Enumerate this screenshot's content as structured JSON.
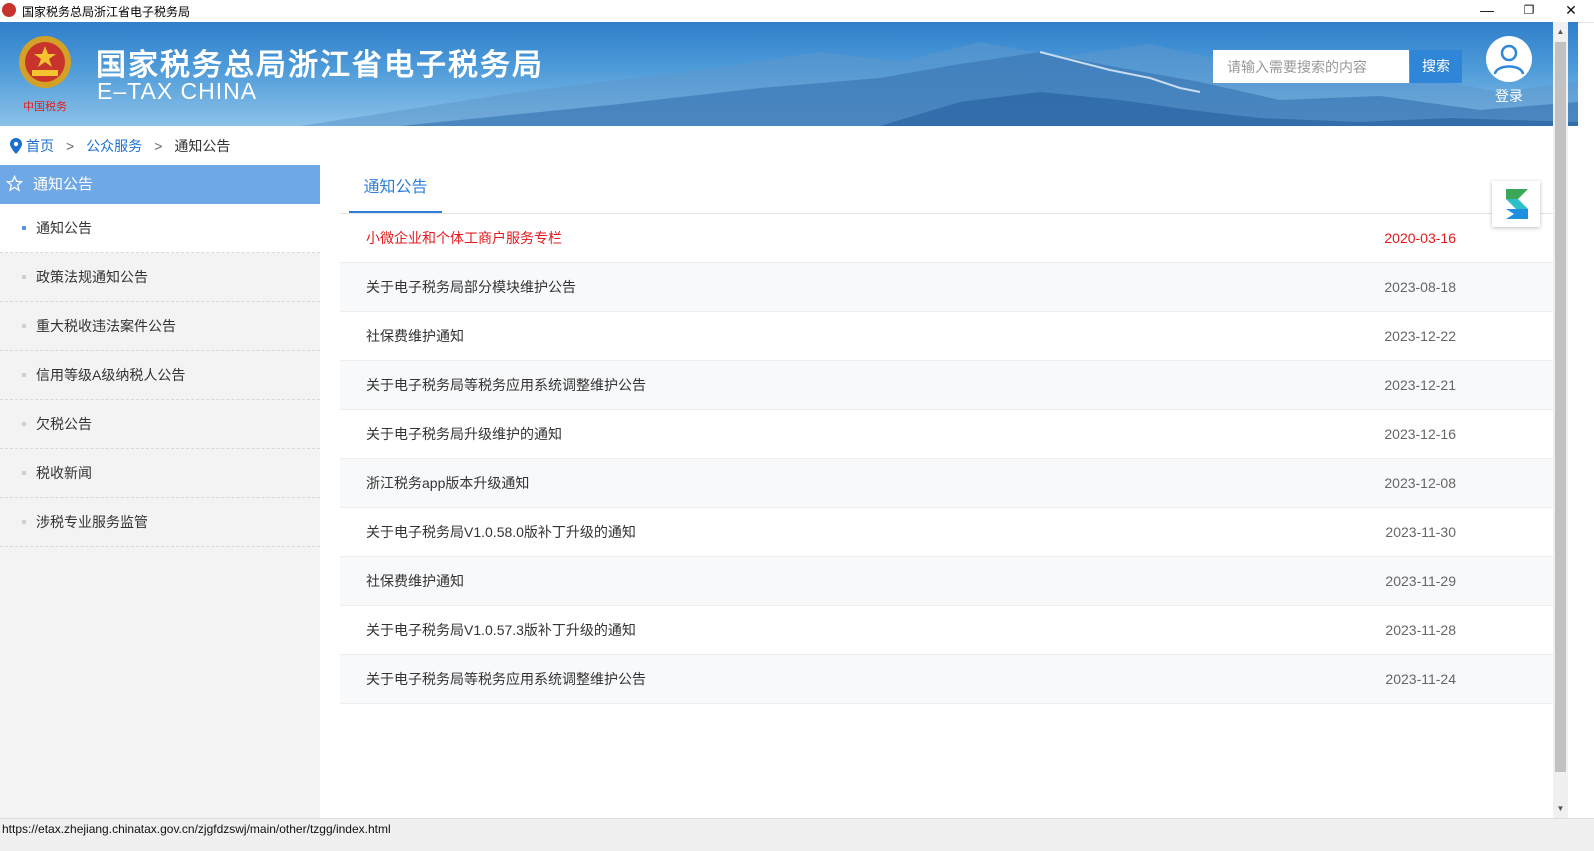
{
  "window": {
    "title": "国家税务总局浙江省电子税务局",
    "minimize": "—",
    "maximize": "❐",
    "close": "✕"
  },
  "header": {
    "title": "国家税务总局浙江省电子税务局",
    "subtitle": "E–TAX CHINA",
    "emblem_caption": "中国税务",
    "search_placeholder": "请输入需要搜索的内容",
    "search_button": "搜索",
    "login_label": "登录"
  },
  "breadcrumb": {
    "home": "首页",
    "sep": ">",
    "public_service": "公众服务",
    "current": "通知公告"
  },
  "sidebar": {
    "heading": "通知公告",
    "items": [
      {
        "label": "通知公告",
        "active": true
      },
      {
        "label": "政策法规通知公告"
      },
      {
        "label": "重大税收违法案件公告"
      },
      {
        "label": "信用等级A级纳税人公告"
      },
      {
        "label": "欠税公告"
      },
      {
        "label": "税收新闻"
      },
      {
        "label": "涉税专业服务监管"
      }
    ]
  },
  "content": {
    "tab": "通知公告",
    "notices": [
      {
        "title": "小微企业和个体工商户服务专栏",
        "date": "2020-03-16",
        "highlight": true
      },
      {
        "title": "关于电子税务局部分模块维护公告",
        "date": "2023-08-18"
      },
      {
        "title": "社保费维护通知",
        "date": "2023-12-22"
      },
      {
        "title": "关于电子税务局等税务应用系统调整维护公告",
        "date": "2023-12-21"
      },
      {
        "title": "关于电子税务局升级维护的通知",
        "date": "2023-12-16"
      },
      {
        "title": "浙江税务app版本升级通知",
        "date": "2023-12-08"
      },
      {
        "title": "关于电子税务局V1.0.58.0版补丁升级的通知",
        "date": "2023-11-30"
      },
      {
        "title": "社保费维护通知",
        "date": "2023-11-29"
      },
      {
        "title": "关于电子税务局V1.0.57.3版补丁升级的通知",
        "date": "2023-11-28"
      },
      {
        "title": "关于电子税务局等税务应用系统调整维护公告",
        "date": "2023-11-24"
      }
    ]
  },
  "statusbar": {
    "url": "https://etax.zhejiang.chinatax.gov.cn/zjgfdzswj/main/other/tzgg/index.html"
  },
  "colors": {
    "accent": "#2f86d9",
    "sidebar_header": "#6fa8e6",
    "highlight": "#e5191d",
    "link": "#1a6fd1"
  }
}
